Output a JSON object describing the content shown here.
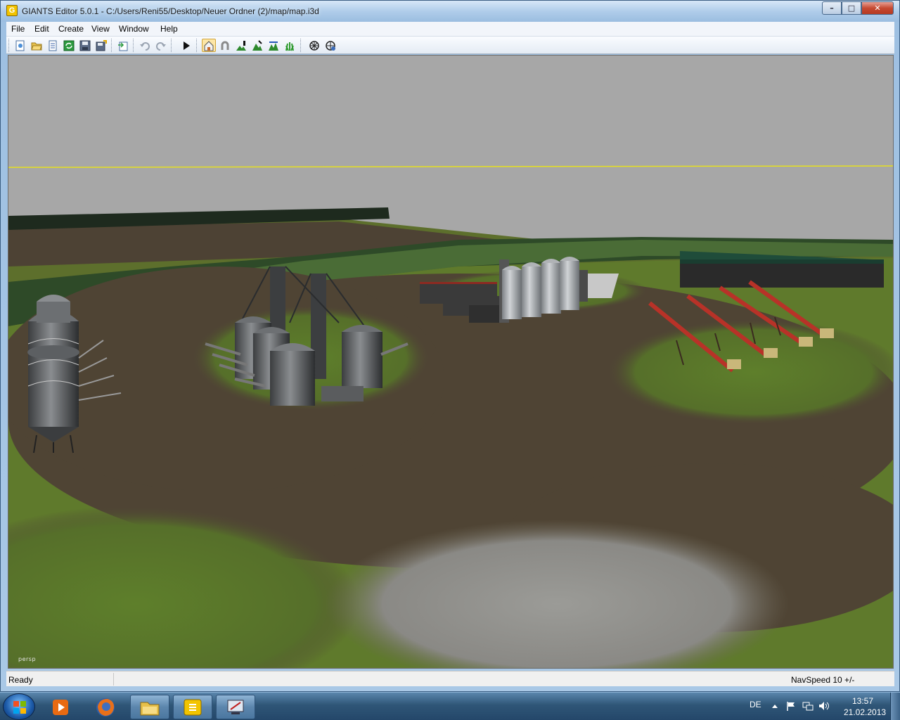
{
  "window": {
    "title": "GIANTS Editor 5.0.1 - C:/Users/Reni55/Desktop/Neuer Ordner (2)/map/map.i3d",
    "app_icon": "G",
    "minimize": "–",
    "maximize": "□",
    "close": "✕"
  },
  "menubar": {
    "items": [
      "File",
      "Edit",
      "Create",
      "View",
      "Window",
      "Help"
    ]
  },
  "toolbar": {
    "buttons": [
      {
        "icon": "new-scene-icon"
      },
      {
        "icon": "open-folder-icon"
      },
      {
        "icon": "document-list-icon"
      },
      {
        "icon": "refresh-icon"
      },
      {
        "icon": "save-icon"
      },
      {
        "icon": "save-all-icon"
      },
      {
        "icon": "import-icon"
      },
      {
        "icon": "undo-icon"
      },
      {
        "icon": "redo-icon"
      },
      {
        "icon": "play-icon"
      },
      {
        "icon": "home-icon",
        "active": true
      },
      {
        "icon": "magnet-icon"
      },
      {
        "icon": "terrain-paint-icon"
      },
      {
        "icon": "terrain-sculpt-icon"
      },
      {
        "icon": "terrain-smooth-icon"
      },
      {
        "icon": "foliage-paint-icon"
      },
      {
        "icon": "grid-icon"
      },
      {
        "icon": "grid-settings-icon"
      }
    ]
  },
  "viewport": {
    "camera_label": "persp"
  },
  "statusbar": {
    "status": "Ready",
    "navspeed": "NavSpeed 10 +/-"
  },
  "taskbar": {
    "language": "DE",
    "time": "13:57",
    "date": "21.02.2013",
    "apps": [
      {
        "icon": "media-player-icon",
        "state": "pinned"
      },
      {
        "icon": "firefox-icon",
        "state": "pinned"
      },
      {
        "icon": "explorer-icon",
        "state": "open"
      },
      {
        "icon": "giants-editor-icon",
        "state": "open"
      },
      {
        "icon": "remote-tool-icon",
        "state": "open"
      }
    ]
  },
  "colors": {
    "sky": "#a7a7a7",
    "grass": "#5e7a2a",
    "soil": "#4f4434",
    "trees": "#2d4a2d",
    "horizon_line": "#e6e020",
    "auger_red": "#b83228"
  }
}
